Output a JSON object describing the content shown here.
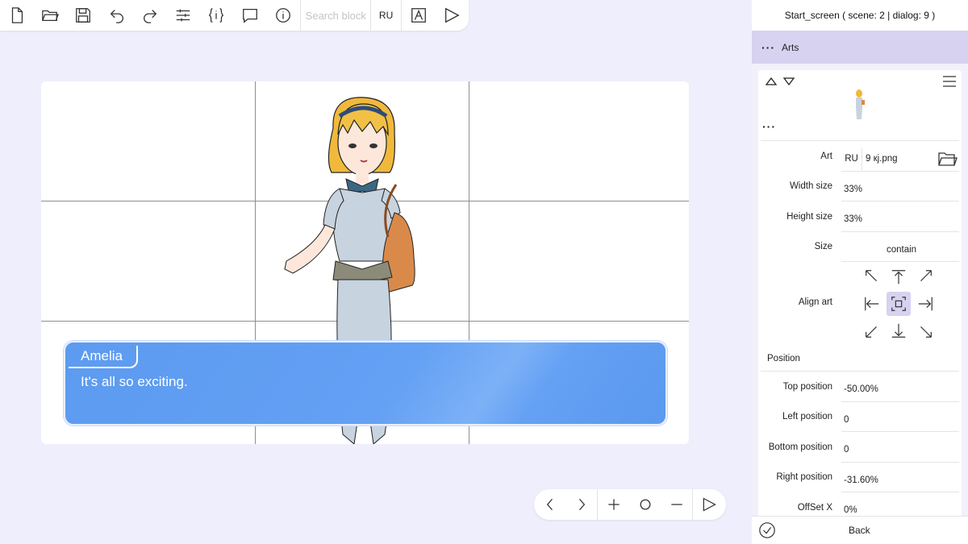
{
  "toolbar": {
    "icons": [
      "new-file-icon",
      "open-folder-icon",
      "save-icon",
      "undo-icon",
      "redo-icon",
      "settings-sliders-icon",
      "variables-icon",
      "comment-icon",
      "info-icon"
    ],
    "search_placeholder": "Search block",
    "language": "RU",
    "preview_icon": "text-style-icon",
    "play_icon": "play-icon"
  },
  "stage": {
    "dialog": {
      "name": "Amelia",
      "text": "It's all so exciting.",
      "bg_color": "#64a0f4"
    }
  },
  "bottom_nav": {
    "icons": [
      "chevron-left-icon",
      "chevron-right-icon",
      "zoom-in-icon",
      "zoom-reset-icon",
      "zoom-out-icon",
      "play-icon"
    ]
  },
  "panel": {
    "title": "Start_screen ( scene: 2 | dialog: 9 )",
    "section": "Arts",
    "art": {
      "label": "Art",
      "lang": "RU",
      "file": "9 кј.png"
    },
    "fields": [
      {
        "label": "Width size",
        "value": "33%"
      },
      {
        "label": "Height size",
        "value": "33%"
      },
      {
        "label": "Size",
        "value": "contain"
      }
    ],
    "align_label": "Align art",
    "position_label": "Position",
    "position_fields": [
      {
        "label": "Top position",
        "value": "-50.00%"
      },
      {
        "label": "Left position",
        "value": "0"
      },
      {
        "label": "Bottom position",
        "value": "0"
      },
      {
        "label": "Right position",
        "value": "-31.60%"
      },
      {
        "label": "OffSet X",
        "value": "0%"
      }
    ],
    "back_label": "Back"
  },
  "colors": {
    "background": "#efeefc",
    "section_header": "#d6d2f0",
    "accent_active": "#d6d2f0"
  }
}
